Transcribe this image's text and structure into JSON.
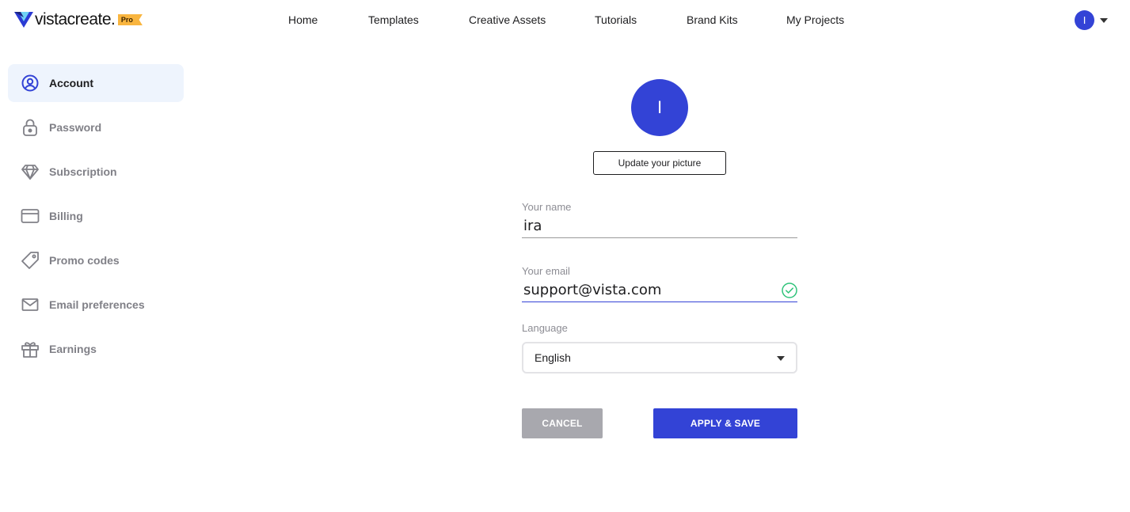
{
  "brand": {
    "logo_text": "vistacreate",
    "badge": "Pro",
    "accent_color": "#3343d6",
    "badge_color": "#f9b53f"
  },
  "nav": {
    "items": [
      {
        "label": "Home"
      },
      {
        "label": "Templates"
      },
      {
        "label": "Creative Assets"
      },
      {
        "label": "Tutorials"
      },
      {
        "label": "Brand Kits"
      },
      {
        "label": "My Projects"
      }
    ]
  },
  "user": {
    "initial": "I"
  },
  "sidebar": {
    "items": [
      {
        "label": "Account",
        "icon": "user-circle-icon",
        "active": true
      },
      {
        "label": "Password",
        "icon": "lock-icon",
        "active": false
      },
      {
        "label": "Subscription",
        "icon": "diamond-icon",
        "active": false
      },
      {
        "label": "Billing",
        "icon": "credit-card-icon",
        "active": false
      },
      {
        "label": "Promo codes",
        "icon": "tag-icon",
        "active": false
      },
      {
        "label": "Email preferences",
        "icon": "envelope-icon",
        "active": false
      },
      {
        "label": "Earnings",
        "icon": "gift-icon",
        "active": false
      }
    ]
  },
  "profile": {
    "avatar_initial": "I",
    "update_picture_label": "Update your picture",
    "name_label": "Your name",
    "name_value": "ira",
    "email_label": "Your email",
    "email_value": "support@vista.com",
    "email_valid_color": "#2fc37a",
    "language_label": "Language",
    "language_value": "English",
    "cancel_label": "CANCEL",
    "save_label": "APPLY & SAVE"
  }
}
